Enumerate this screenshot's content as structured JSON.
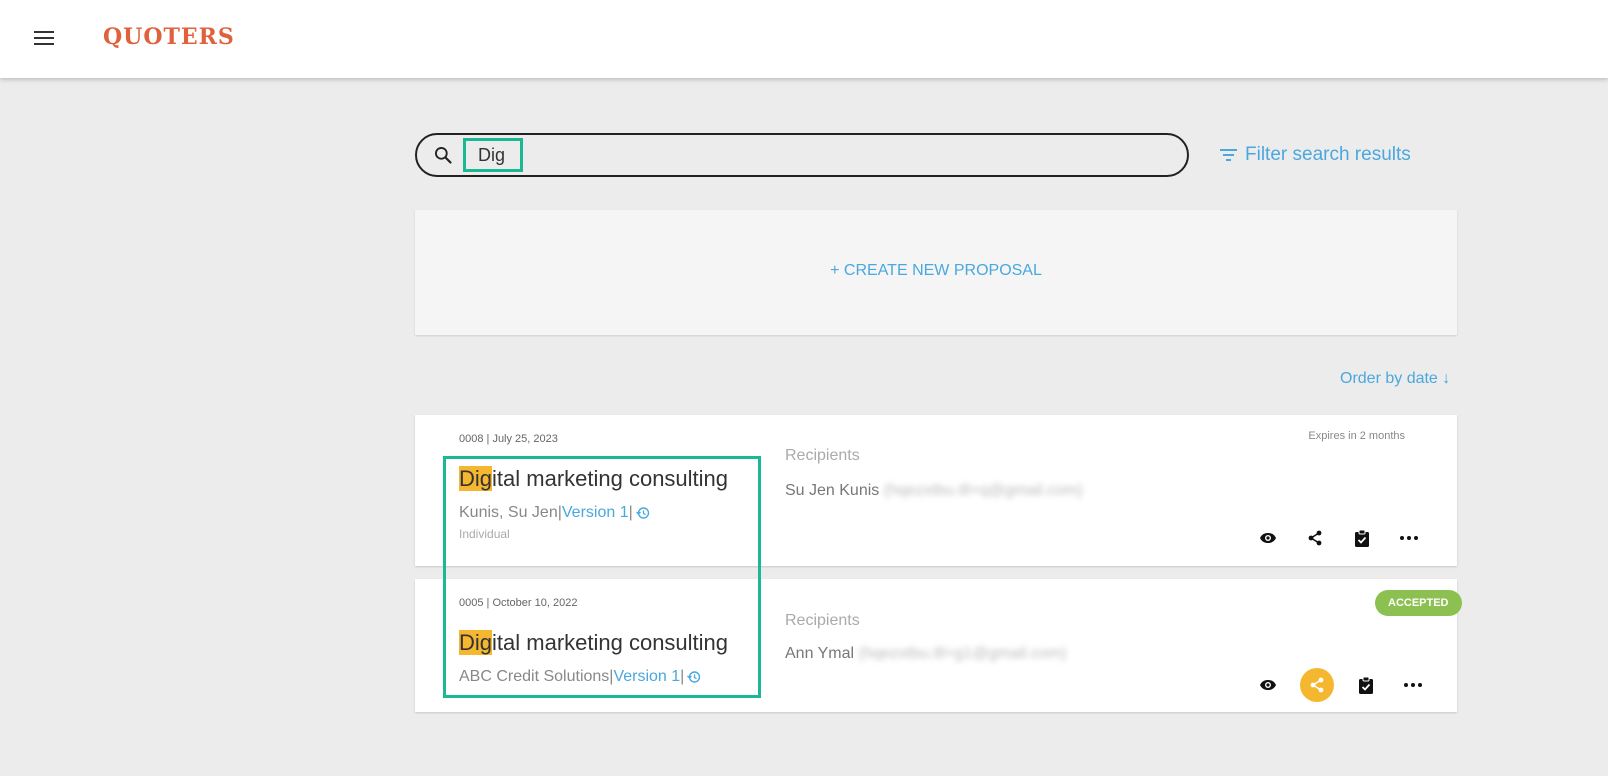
{
  "header": {
    "brand": "QUOTERS"
  },
  "search": {
    "value": "Dig"
  },
  "filter": {
    "label": "Filter search results"
  },
  "create": {
    "label": "+ CREATE NEW PROPOSAL"
  },
  "order": {
    "label": "Order by date"
  },
  "proposals": [
    {
      "meta": "0008 | July 25, 2023",
      "title_match": "Dig",
      "title_rest": "ital marketing consulting",
      "client": "Kunis, Su Jen",
      "version": "Version 1",
      "type": "Individual",
      "recipients_label": "Recipients",
      "recipient_name": "Su Jen Kunis",
      "recipient_email": "(hqezxtbu.tll+q@gmail.com)",
      "expires": "Expires in 2 months"
    },
    {
      "meta": "0005 | October 10, 2022",
      "title_match": "Dig",
      "title_rest": "ital marketing consulting",
      "client": "ABC Credit Solutions",
      "version": "Version 1",
      "recipients_label": "Recipients",
      "recipient_name": "Ann Ymal",
      "recipient_email": "(hqezxtbu.tll+g1@gmail.com)",
      "status": "ACCEPTED"
    }
  ],
  "colors": {
    "brand": "#e0623c",
    "accent": "#4aa8de",
    "highlight": "#f6b730",
    "focus": "#1ab893",
    "accepted": "#8cc152"
  }
}
